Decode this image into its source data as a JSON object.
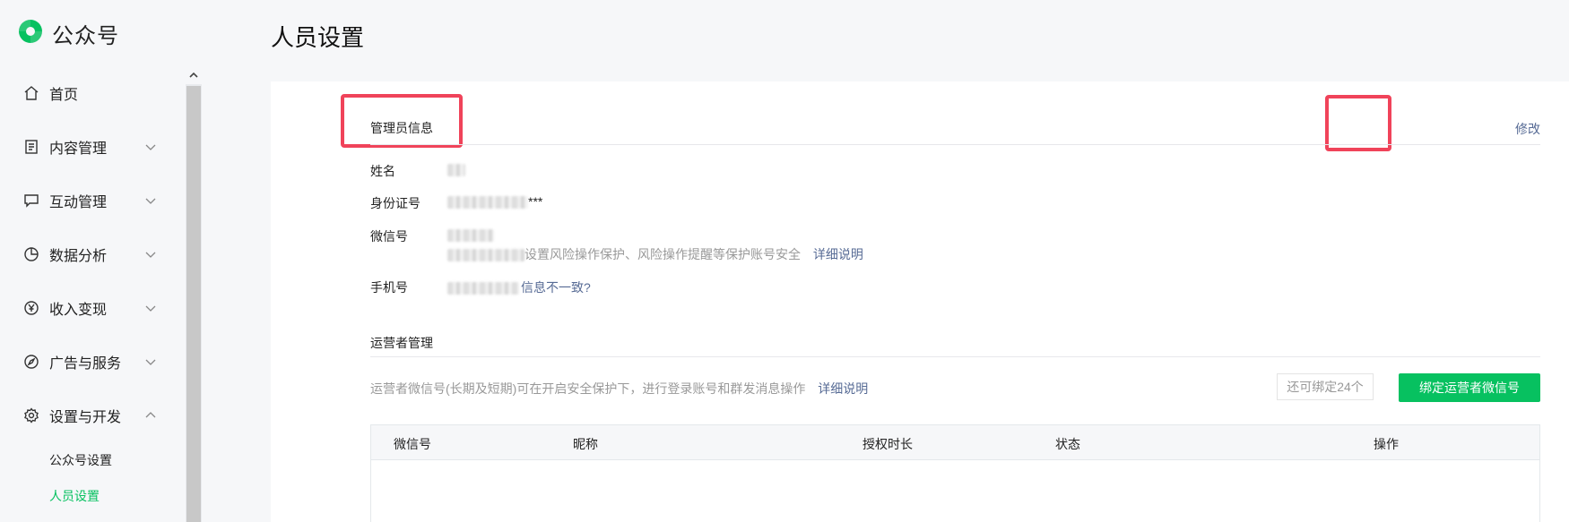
{
  "app": {
    "name": "公众号"
  },
  "sidebar": {
    "items": [
      {
        "label": "首页",
        "icon": "home-icon",
        "expandable": false
      },
      {
        "label": "内容管理",
        "icon": "document-icon",
        "expandable": true
      },
      {
        "label": "互动管理",
        "icon": "chat-icon",
        "expandable": true
      },
      {
        "label": "数据分析",
        "icon": "pie-chart-icon",
        "expandable": true
      },
      {
        "label": "收入变现",
        "icon": "yuan-icon",
        "expandable": true
      },
      {
        "label": "广告与服务",
        "icon": "compass-icon",
        "expandable": true
      },
      {
        "label": "设置与开发",
        "icon": "gear-icon",
        "expandable": true,
        "expanded": true
      }
    ],
    "sub_items": [
      {
        "label": "公众号设置",
        "active": false
      },
      {
        "label": "人员设置",
        "active": true
      }
    ]
  },
  "page": {
    "title": "人员设置"
  },
  "admin": {
    "title": "管理员信息",
    "edit_label": "修改",
    "name_label": "姓名",
    "id_label": "身份证号",
    "id_suffix": "***",
    "wechat_label": "微信号",
    "wechat_desc": "设置风险操作保护、风险操作提醒等保护账号安全",
    "wechat_link": "详细说明",
    "phone_label": "手机号",
    "phone_link": "信息不一致?"
  },
  "operators": {
    "title": "运营者管理",
    "desc": "运营者微信号(长期及短期)可在开启安全保护下，进行登录账号和群发消息操作",
    "desc_link": "详细说明",
    "remaining": "还可绑定24个",
    "bind_button": "绑定运营者微信号",
    "columns": [
      "微信号",
      "昵称",
      "授权时长",
      "状态",
      "操作"
    ]
  },
  "colors": {
    "accent": "#07c160",
    "link": "#576b95",
    "highlight": "#f0435a"
  }
}
